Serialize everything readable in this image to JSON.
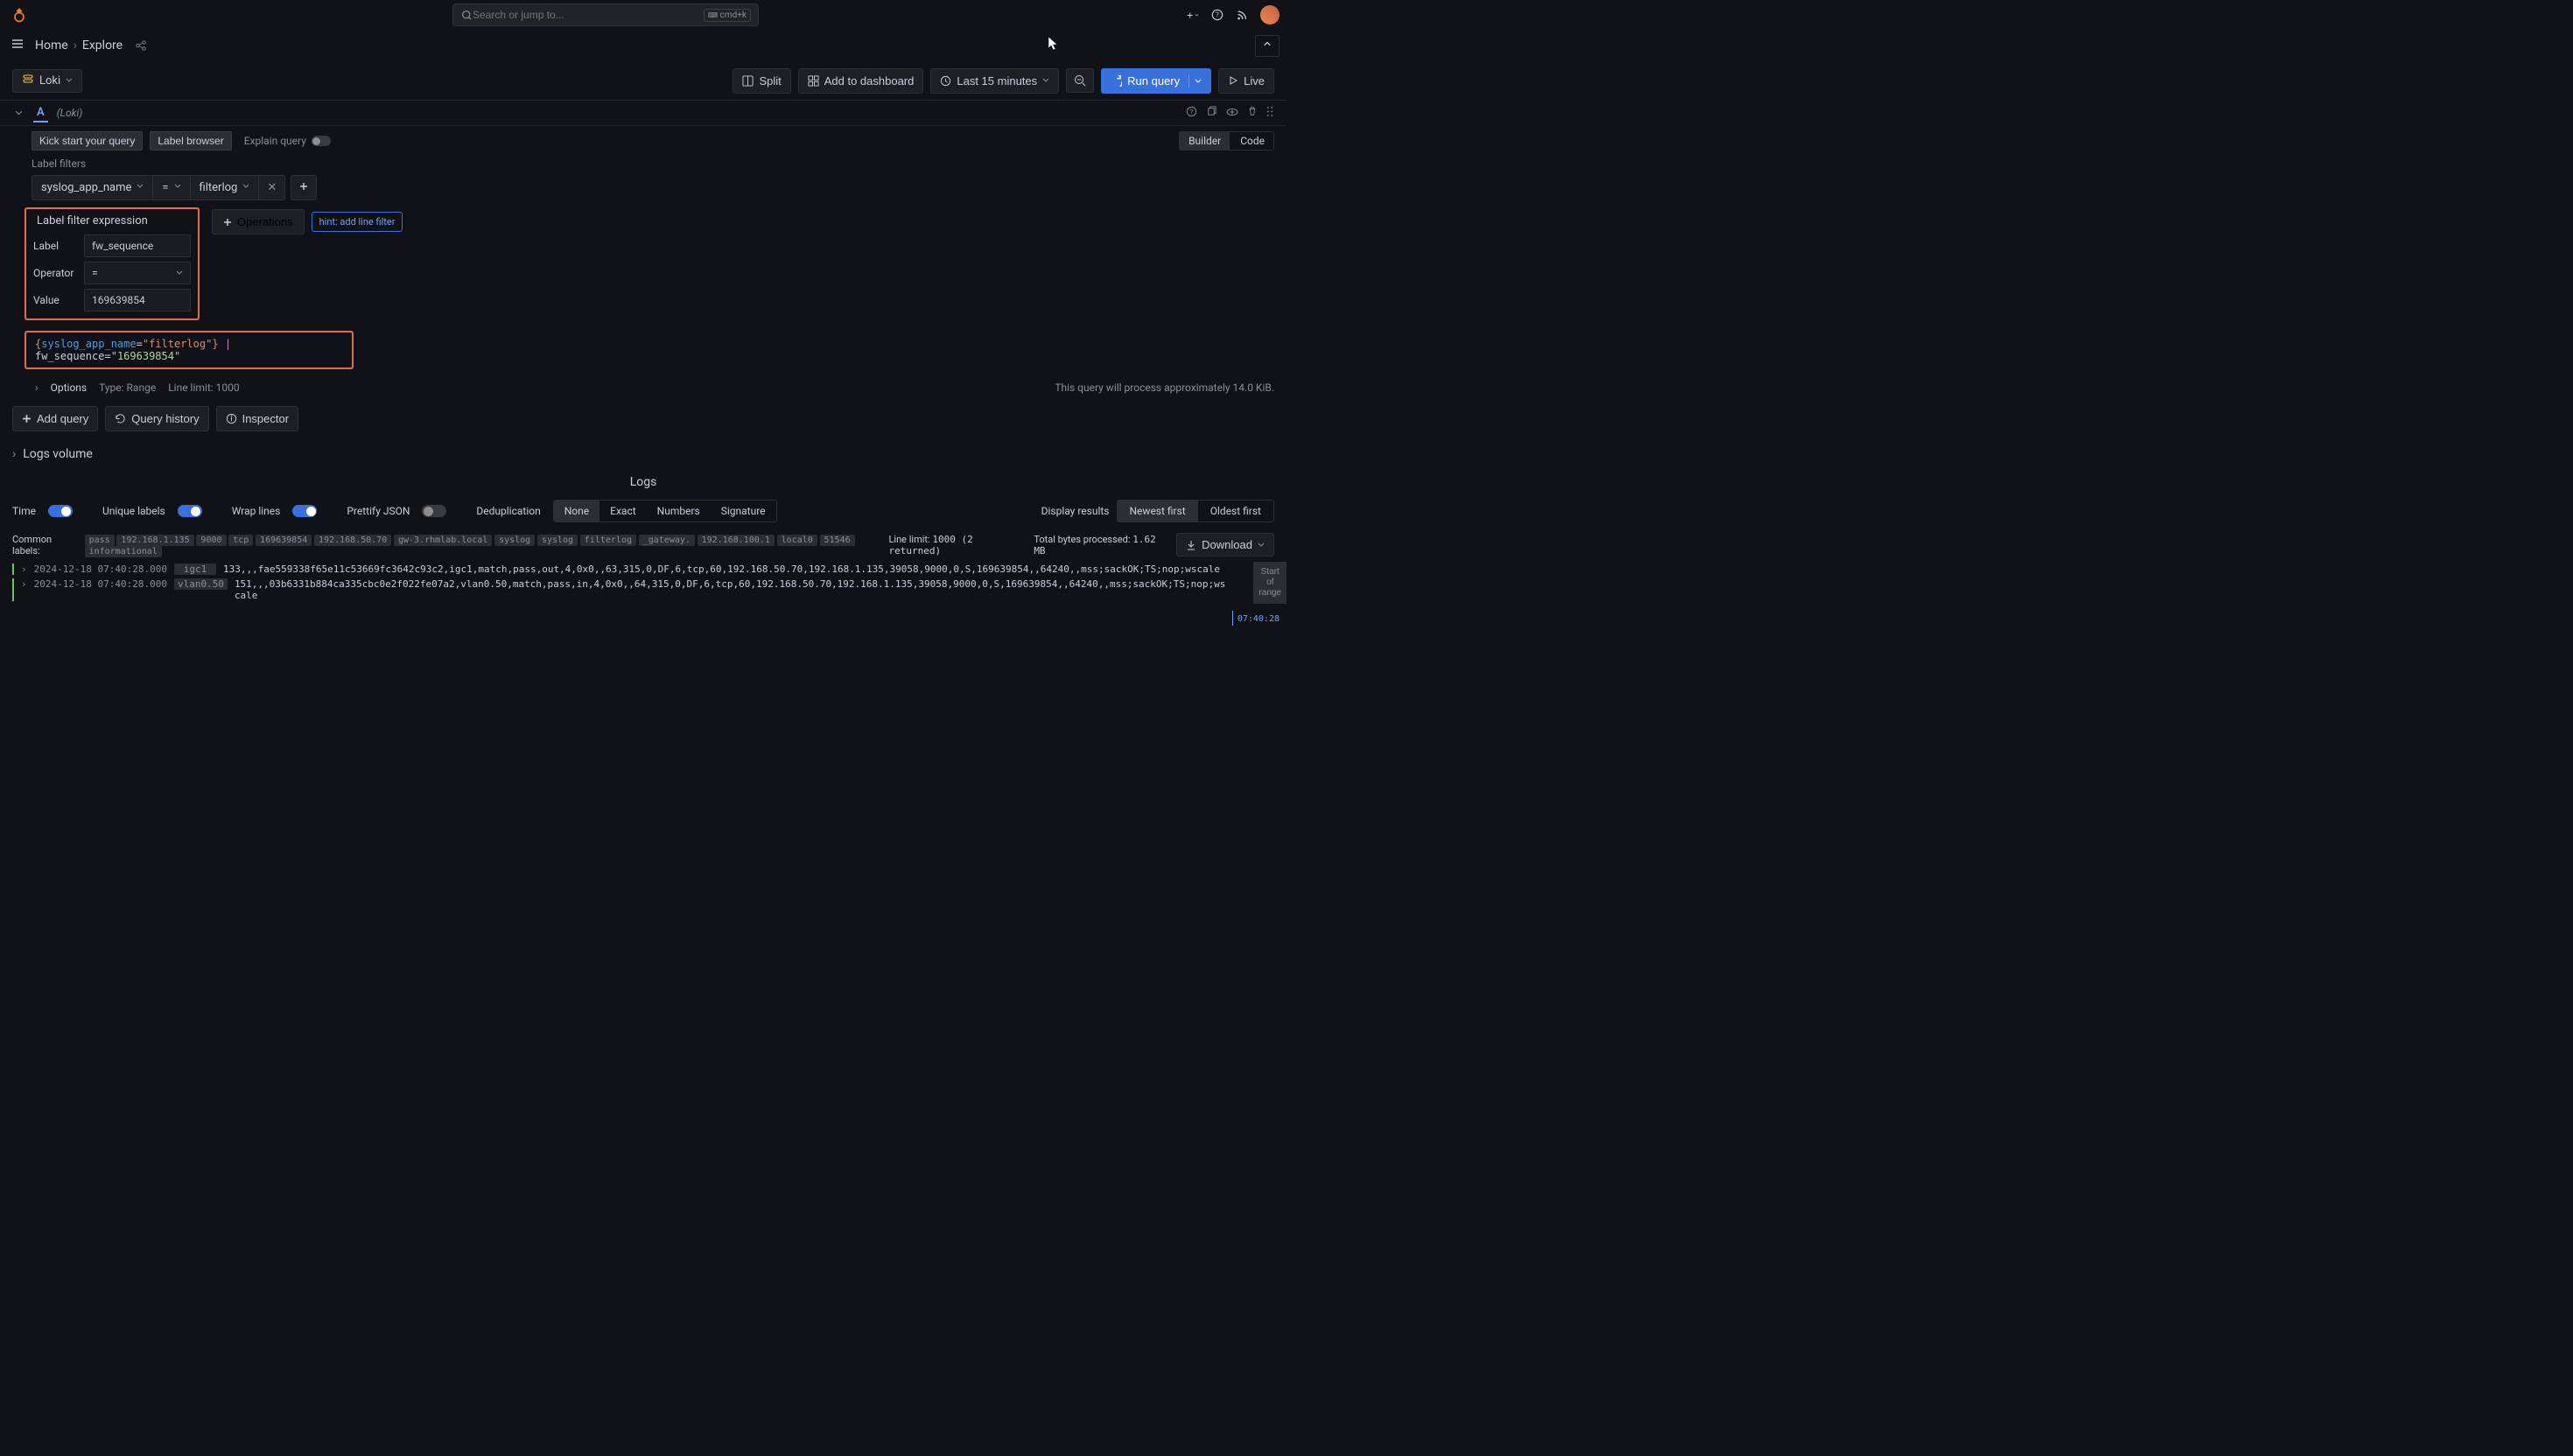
{
  "topbar": {
    "search_placeholder": "Search or jump to...",
    "search_kbd": "cmd+k"
  },
  "nav": {
    "home": "Home",
    "explore": "Explore"
  },
  "toolbar": {
    "datasource": "Loki",
    "split": "Split",
    "add_dashboard": "Add to dashboard",
    "timerange": "Last 15 minutes",
    "run_query": "Run query",
    "live": "Live"
  },
  "query": {
    "letter": "A",
    "source": "(Loki)",
    "kick_start": "Kick start your query",
    "label_browser": "Label browser",
    "explain_query": "Explain query",
    "mode_builder": "Builder",
    "mode_code": "Code",
    "label_filters_title": "Label filters",
    "filter": {
      "label": "syslog_app_name",
      "op": "=",
      "value": "filterlog"
    },
    "expr_title": "Label filter expression",
    "expr_label_lbl": "Label",
    "expr_label_val": "fw_sequence",
    "expr_op_lbl": "Operator",
    "expr_op_val": "=",
    "expr_value_lbl": "Value",
    "expr_value_val": "169639854",
    "operations": "Operations",
    "hint": "hint: add line filter",
    "options": "Options",
    "options_type": "Type: Range",
    "options_limit": "Line limit: 1000",
    "process_info": "This query will process approximately 14.0 KiB."
  },
  "query_text": {
    "raw": "{syslog_app_name=\"filterlog\"} | fw_sequence=\"169639854\""
  },
  "actions": {
    "add_query": "Add query",
    "query_history": "Query history",
    "inspector": "Inspector"
  },
  "logs": {
    "volume_title": "Logs volume",
    "logs_title": "Logs",
    "ctrl_time": "Time",
    "ctrl_unique": "Unique labels",
    "ctrl_wrap": "Wrap lines",
    "ctrl_prettify": "Prettify JSON",
    "ctrl_dedup": "Deduplication",
    "dedup": {
      "none": "None",
      "exact": "Exact",
      "numbers": "Numbers",
      "signature": "Signature"
    },
    "display_results": "Display results",
    "newest_first": "Newest first",
    "oldest_first": "Oldest first",
    "common_labels": "Common labels:",
    "labels": [
      "pass",
      "192.168.1.135",
      "9000",
      "tcp",
      "169639854",
      "192.168.50.70",
      "gw-3.rhmlab.local",
      "syslog",
      "syslog",
      "filterlog",
      "_gateway.",
      "192.168.100.1",
      "local0",
      "51546",
      "informational"
    ],
    "line_limit": "Line limit:",
    "line_limit_val": "1000 (2 returned)",
    "bytes": "Total bytes processed:",
    "bytes_val": "1.62 MB",
    "download": "Download",
    "range_marker": "Start\nof\nrange",
    "timeline_tick": "07:40:28",
    "entries": [
      {
        "ts": "2024-12-18 07:40:28.000",
        "src": "igc1",
        "msg": "133,,,fae559338f65e11c53669fc3642c93c2,igc1,match,pass,out,4,0x0,,63,315,0,DF,6,tcp,60,192.168.50.70,192.168.1.135,39058,9000,0,S,169639854,,64240,,mss;sackOK;TS;nop;wscale"
      },
      {
        "ts": "2024-12-18 07:40:28.000",
        "src": "vlan0.50",
        "msg": "151,,,03b6331b884ca335cbc0e2f022fe07a2,vlan0.50,match,pass,in,4,0x0,,64,315,0,DF,6,tcp,60,192.168.50.70,192.168.1.135,39058,9000,0,S,169639854,,64240,,mss;sackOK;TS;nop;wscale"
      }
    ]
  }
}
